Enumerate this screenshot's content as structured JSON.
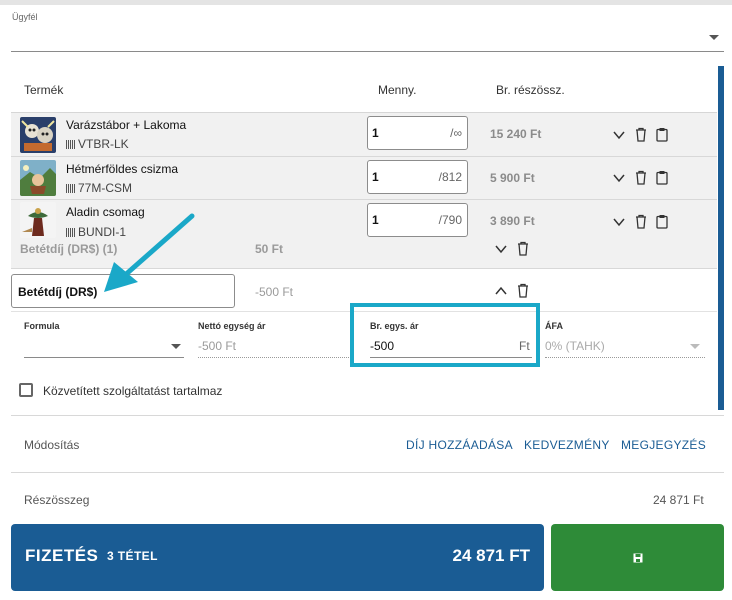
{
  "customer": {
    "label": "Ügyfél",
    "value": ""
  },
  "table": {
    "headers": {
      "product": "Termék",
      "quantity": "Menny.",
      "subtotal": "Br. részössz."
    }
  },
  "items": [
    {
      "name": "Varázstábor + Lakoma",
      "code": "VTBR-LK",
      "qty": "1",
      "max": "/∞",
      "price": "15 240 Ft"
    },
    {
      "name": "Hétmérföldes csizma",
      "code": "77M-CSM",
      "qty": "1",
      "max": "/812",
      "price": "5 900 Ft"
    },
    {
      "name": "Aladin csomag",
      "code": "BUNDI-1",
      "qty": "1",
      "max": "/790",
      "price": "3 890 Ft"
    }
  ],
  "deposit_row": {
    "label": "Betétdíj (DR$) (1)",
    "price": "50 Ft"
  },
  "deposit_edit": {
    "value": "Betétdíj (DR$)",
    "price": "-500 Ft"
  },
  "fields": {
    "formula": {
      "label": "Formula",
      "value": ""
    },
    "net": {
      "label": "Nettó egység ár",
      "value": "-500 Ft"
    },
    "gross": {
      "label": "Br. egys. ár",
      "value": "-500",
      "unit": "Ft"
    },
    "vat": {
      "label": "ÁFA",
      "value": "0% (TAHK)"
    }
  },
  "checkbox": {
    "label": "Közvetített szolgáltatást tartalmaz"
  },
  "modifiers": {
    "label": "Módosítás",
    "add_fee": "DÍJ HOZZÁADÁSA",
    "discount": "KEDVEZMÉNY",
    "note": "MEGJEGYZÉS"
  },
  "subtotal": {
    "label": "Részösszeg",
    "value": "24 871 Ft"
  },
  "payment": {
    "label": "FIZETÉS",
    "count": "3 TÉTEL",
    "total": "24 871 FT"
  },
  "colors": {
    "primary": "#1a5c94",
    "save": "#2e8b38",
    "highlight": "#1aa8c8",
    "arrow": "#1aa8c8"
  }
}
